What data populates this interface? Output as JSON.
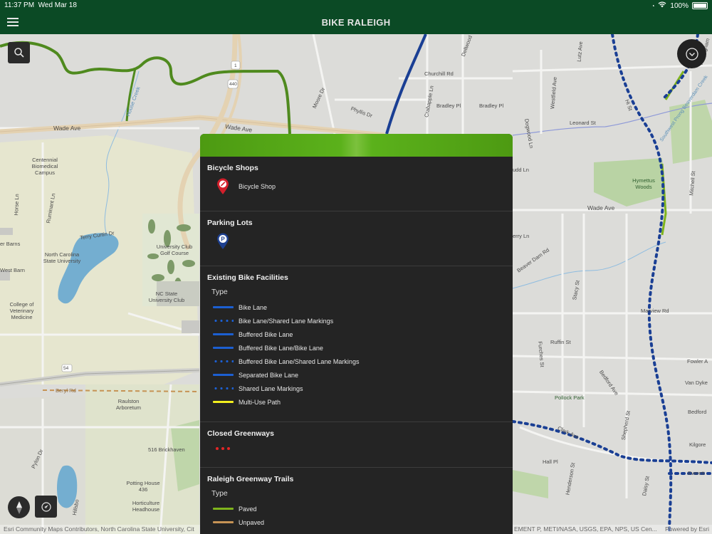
{
  "status_bar": {
    "time": "11:37 PM",
    "date": "Wed Mar 18",
    "battery": "100%"
  },
  "nav": {
    "title": "BIKE RALEIGH",
    "menu_icon": "hamburger-icon"
  },
  "map": {
    "labels": {
      "wade_ave_w": "Wade Ave",
      "wade_ave_mid": "Wade Ave",
      "wade_ave_e": "Wade Ave",
      "house_creek": "House Creek",
      "moore_dr": "Moore Dr",
      "phyllis_dr": "Phyllis Dr",
      "delwood": "Dellwood",
      "churchill_rd": "Churchill Rd",
      "crabapple_ln": "Crabapple Ln",
      "bradley_pl_1": "Bradley Pl",
      "bradley_pl_2": "Bradley Pl",
      "dogwood_ln": "Dogwood Ln",
      "westfield_ave": "Westfield Ave",
      "lutz_ave": "Lutz Ave",
      "leonard_st": "Leonard St",
      "hi_st": "Hi St",
      "southwest_prong": "Southwest Prong Beaverdam Creek",
      "nottingham": "Nottingham",
      "hymettus_woods": "Hymettus Woods",
      "mitchell_st": "Mitchell St",
      "budd_ln": "udd Ln",
      "perry_ln": "erry Ln",
      "beaver_dam_rd": "Beaver Dam Rd",
      "stacy_st": "Stacy St",
      "marview_rd": "Marview Rd",
      "ruffin_st": "Ruffin St",
      "furches_st": "Furches St",
      "bedford_ave": "Bedford Ave",
      "fowler_a": "Fowler A",
      "van_dyke": "Van Dyke",
      "bedford": "Bedford",
      "pollock_park": "Pollock Park",
      "shepherd_st": "Shepherd St",
      "clark_ave": "Clark Ave",
      "kilgore": "Kilgore",
      "hall_pl": "Hall Pl",
      "henderson_st": "Henderson St",
      "daisy_st": "Daisy St",
      "everett": "Everett",
      "centennial": "Centennial Biomedical Campus",
      "horse_ln": "Horse Ln",
      "ruminant_ln": "Ruminant Ln",
      "terry_curtin": "Terry Curtin Dr",
      "ncsu": "North Carolina State University",
      "barns": "er Barns",
      "west_barn": "West Barn",
      "vet_medicine": "College of Veterinary Medicine",
      "univ_club_golf": "University Club Golf Course",
      "nc_state_univ_club": "NC State University Club",
      "beryl_rd": "Beryl Rd",
      "raulston": "Raulston Arboretum",
      "brickhaven": "516 Brickhaven",
      "pylon_dr": "Pylon Dr",
      "potting_house": "Potting House 436",
      "horticulture": "Horticulture Headhouse",
      "hillsborough": "Hillsbo",
      "shield_1": "1",
      "shield_440": "440",
      "shield_54": "54"
    },
    "controls": {
      "search_icon": "search-icon",
      "expand_icon": "chevron-down-icon",
      "compass_icon": "compass-icon",
      "locate_icon": "location-arrow-icon"
    },
    "attribution": {
      "left": "Esri Community Maps Contributors, North Carolina State University, Cit",
      "middle": "EMENT P, METI/NASA, USGS, EPA, NPS, US Cen...",
      "right": "Powered by Esri"
    }
  },
  "legend": {
    "sections": {
      "bicycle_shops": {
        "title": "Bicycle Shops",
        "item": "Bicycle Shop",
        "icon": "bicycle-shop-pin-icon"
      },
      "parking_lots": {
        "title": "Parking Lots",
        "icon": "parking-pin-icon"
      },
      "bike_facilities": {
        "title": "Existing Bike Facilities",
        "type_label": "Type",
        "items": [
          {
            "label": "Bike Lane",
            "style": "solid",
            "color": "#1c5fd1"
          },
          {
            "label": "Bike Lane/Shared Lane Markings",
            "style": "dotted",
            "color": "#1c5fd1"
          },
          {
            "label": "Buffered Bike Lane",
            "style": "solid",
            "color": "#1c5fd1"
          },
          {
            "label": "Buffered Bike Lane/Bike Lane",
            "style": "solid",
            "color": "#1c5fd1"
          },
          {
            "label": "Buffered Bike Lane/Shared Lane Markings",
            "style": "dotted",
            "color": "#1c5fd1"
          },
          {
            "label": "Separated Bike Lane",
            "style": "solid",
            "color": "#1c5fd1"
          },
          {
            "label": "Shared Lane Markings",
            "style": "dotted",
            "color": "#1c5fd1"
          },
          {
            "label": "Multi-Use Path",
            "style": "solid",
            "color": "#f2ee1e"
          }
        ]
      },
      "closed_greenways": {
        "title": "Closed Greenways",
        "color": "#e32626"
      },
      "greenway_trails": {
        "title": "Raleigh Greenway Trails",
        "type_label": "Type",
        "items": [
          {
            "label": "Paved",
            "color": "#7fb41c"
          },
          {
            "label": "Unpaved",
            "color": "#c69355"
          }
        ]
      }
    }
  }
}
